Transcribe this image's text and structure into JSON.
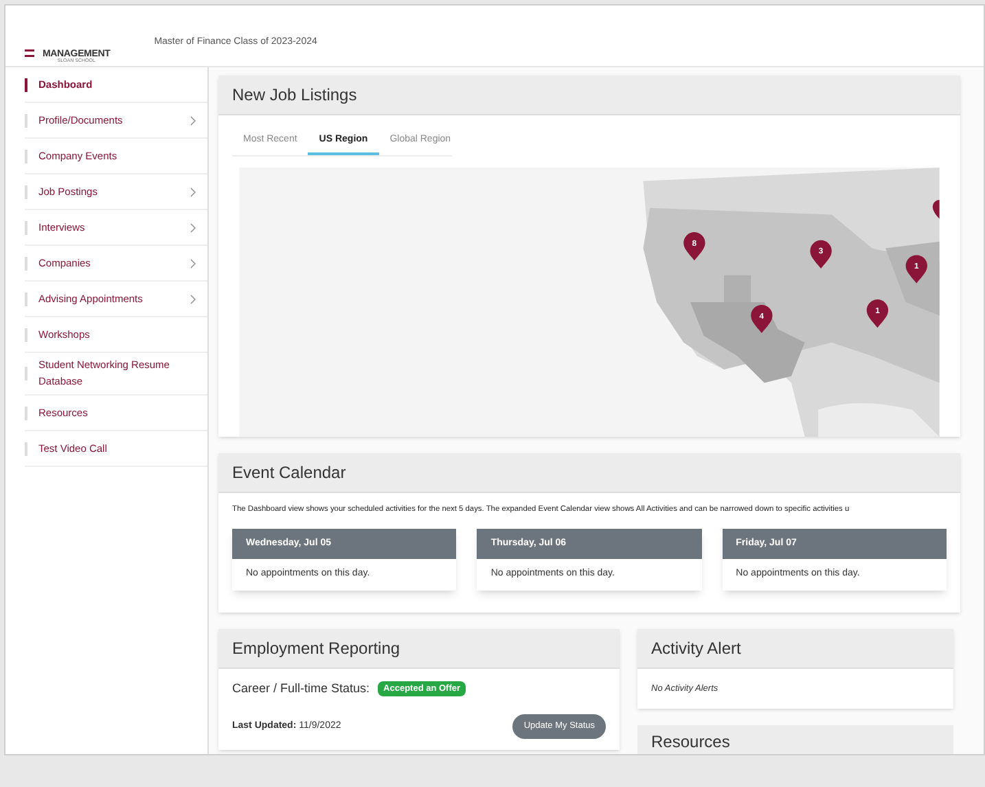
{
  "header": {
    "logo_top": "MANAGEMENT",
    "logo_bottom": "SLOAN SCHOOL",
    "title": "Master of Finance Class of 2023-2024"
  },
  "sidebar": {
    "items": [
      {
        "label": "Dashboard",
        "selected": true,
        "expandable": false
      },
      {
        "label": "Profile/Documents",
        "selected": false,
        "expandable": true
      },
      {
        "label": "Company Events",
        "selected": false,
        "expandable": false
      },
      {
        "label": "Job Postings",
        "selected": false,
        "expandable": true
      },
      {
        "label": "Interviews",
        "selected": false,
        "expandable": true
      },
      {
        "label": "Companies",
        "selected": false,
        "expandable": true
      },
      {
        "label": "Advising Appointments",
        "selected": false,
        "expandable": true
      },
      {
        "label": "Workshops",
        "selected": false,
        "expandable": false
      },
      {
        "label": "Student Networking Resume Database",
        "selected": false,
        "expandable": false
      },
      {
        "label": "Resources",
        "selected": false,
        "expandable": false
      },
      {
        "label": "Test Video Call",
        "selected": false,
        "expandable": false
      }
    ]
  },
  "job_listings": {
    "title": "New Job Listings",
    "tabs": [
      {
        "label": "Most Recent",
        "selected": false
      },
      {
        "label": "US Region",
        "selected": true
      },
      {
        "label": "Global Region",
        "selected": false
      }
    ],
    "map_pins": [
      {
        "count": "8"
      },
      {
        "count": "3"
      },
      {
        "count": "1"
      },
      {
        "count": "4"
      },
      {
        "count": "1"
      }
    ]
  },
  "event_calendar": {
    "title": "Event Calendar",
    "description": "The Dashboard view shows your scheduled activities for the next 5 days. The expanded Event Calendar view shows All Activities and can be narrowed down to specific activities u",
    "days": [
      {
        "date": "Wednesday, Jul 05",
        "message": "No appointments on this day."
      },
      {
        "date": "Thursday, Jul 06",
        "message": "No appointments on this day."
      },
      {
        "date": "Friday, Jul 07",
        "message": "No appointments on this day."
      }
    ]
  },
  "employment_reporting": {
    "title": "Employment Reporting",
    "status_label": "Career / Full-time Status:",
    "status_badge": "Accepted an Offer",
    "updated_label": "Last Updated:",
    "updated_value": "11/9/2022",
    "button": "Update My Status"
  },
  "activity_alert": {
    "title": "Activity Alert",
    "message": "No Activity Alerts"
  },
  "resources": {
    "title": "Resources"
  }
}
